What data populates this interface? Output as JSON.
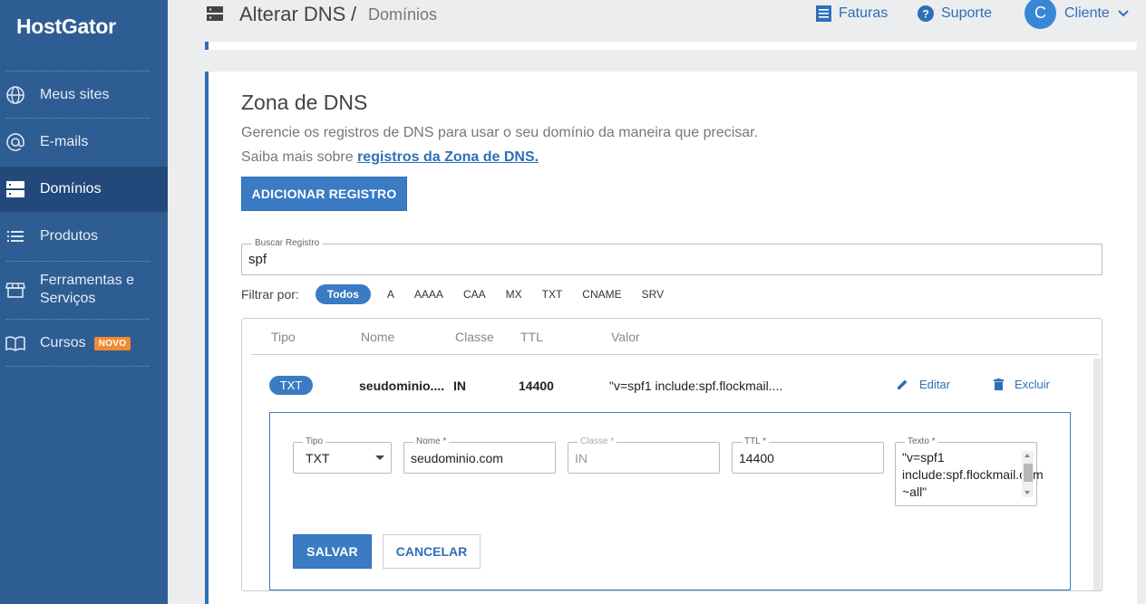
{
  "sidebar": {
    "logo": "HostGator",
    "items": [
      {
        "label": "Meus sites",
        "icon": "globe-icon"
      },
      {
        "label": "E-mails",
        "icon": "at-icon"
      },
      {
        "label": "Domínios",
        "icon": "server-icon",
        "active": true
      },
      {
        "label": "Produtos",
        "icon": "list-icon"
      },
      {
        "label": "Ferramentas e Serviços",
        "icon": "store-icon"
      },
      {
        "label": "Cursos",
        "icon": "book-icon",
        "badge": "NOVO"
      }
    ]
  },
  "header": {
    "title": "Alterar DNS",
    "separator": "/",
    "breadcrumb": "Domínios",
    "links": {
      "invoices": "Faturas",
      "support": "Suporte",
      "client": "Cliente"
    },
    "avatar_initial": "C"
  },
  "main": {
    "title": "Zona de DNS",
    "description": "Gerencie os registros de DNS para usar o seu domínio da maneira que precisar.",
    "learn_more_prefix": "Saiba mais sobre ",
    "learn_more_link": "registros da Zona de DNS.",
    "add_button": "ADICIONAR REGISTRO",
    "search": {
      "label": "Buscar Registro",
      "value": "spf"
    },
    "filter": {
      "label": "Filtrar por:",
      "options": [
        "Todos",
        "A",
        "AAAA",
        "CAA",
        "MX",
        "TXT",
        "CNAME",
        "SRV"
      ],
      "selected": "Todos"
    },
    "table": {
      "columns": [
        "Tipo",
        "Nome",
        "Classe",
        "TTL",
        "Valor"
      ],
      "rows": [
        {
          "type": "TXT",
          "name": "seudominio....",
          "class": "IN",
          "ttl": "14400",
          "value": "\"v=spf1 include:spf.flockmail....",
          "edit": "Editar",
          "delete": "Excluir"
        }
      ]
    },
    "edit_form": {
      "tipo_label": "Tipo",
      "tipo_value": "TXT",
      "nome_label": "Nome *",
      "nome_value": "seudominio.com",
      "classe_label": "Classe *",
      "classe_value": "IN",
      "ttl_label": "TTL *",
      "ttl_value": "14400",
      "texto_label": "Texto *",
      "texto_value": "\"v=spf1 include:spf.flockmail.com ~all\"",
      "save": "SALVAR",
      "cancel": "CANCELAR"
    }
  },
  "colors": {
    "sidebar": "#2e5d93",
    "sidebar_active": "#23497a",
    "accent": "#3b7bc4",
    "link": "#2e6fb8",
    "badge": "#f28a30"
  }
}
